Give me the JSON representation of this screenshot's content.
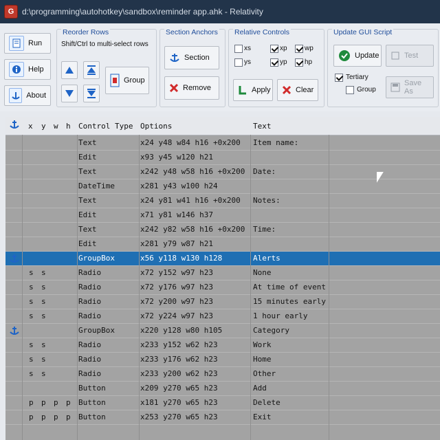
{
  "window": {
    "title": "d:\\programming\\autohotkey\\sandbox\\reminder app.ahk - Relativity"
  },
  "toolbar": {
    "left_buttons": [
      "Run",
      "Help",
      "About"
    ],
    "reorder_rows": {
      "title": "Reorder Rows",
      "hint": "Shift/Ctrl to multi-select rows",
      "group_label": "Group"
    },
    "section_anchors": {
      "title": "Section Anchors",
      "section_label": "Section",
      "remove_label": "Remove"
    },
    "relative_controls": {
      "title": "Relative Controls",
      "checkboxes": [
        {
          "label": "xs",
          "checked": false
        },
        {
          "label": "ys",
          "checked": false
        },
        {
          "label": "xp",
          "checked": true
        },
        {
          "label": "yp",
          "checked": true
        },
        {
          "label": "wp",
          "checked": true
        },
        {
          "label": "hp",
          "checked": true
        }
      ],
      "apply_label": "Apply",
      "clear_label": "Clear"
    },
    "update_gui": {
      "title": "Update GUI Script",
      "update_label": "Update",
      "test_label": "Test",
      "save_label": "Save As",
      "checkboxes": [
        {
          "label": "Tertiary",
          "checked": true
        },
        {
          "label": "Group",
          "checked": false
        }
      ]
    }
  },
  "grid": {
    "headers": [
      "x",
      "y",
      "w",
      "h",
      "Control Type",
      "Options",
      "Text"
    ],
    "rows": [
      {
        "anchor": "",
        "x": "",
        "y": "",
        "w": "",
        "h": "",
        "type": "Text",
        "options": "x24 y48 w84 h16 +0x200",
        "text": "Item name:"
      },
      {
        "anchor": "",
        "x": "",
        "y": "",
        "w": "",
        "h": "",
        "type": "Edit",
        "options": "x93 y45 w120 h21",
        "text": ""
      },
      {
        "anchor": "",
        "x": "",
        "y": "",
        "w": "",
        "h": "",
        "type": "Text",
        "options": "x242 y48 w58 h16 +0x200",
        "text": "Date:"
      },
      {
        "anchor": "",
        "x": "",
        "y": "",
        "w": "",
        "h": "",
        "type": "DateTime",
        "options": "x281 y43 w100 h24",
        "text": ""
      },
      {
        "anchor": "",
        "x": "",
        "y": "",
        "w": "",
        "h": "",
        "type": "Text",
        "options": "x24 y81 w41 h16 +0x200",
        "text": "Notes:"
      },
      {
        "anchor": "",
        "x": "",
        "y": "",
        "w": "",
        "h": "",
        "type": "Edit",
        "options": "x71 y81 w146 h37",
        "text": ""
      },
      {
        "anchor": "",
        "x": "",
        "y": "",
        "w": "",
        "h": "",
        "type": "Text",
        "options": "x242 y82 w58 h16 +0x200",
        "text": "Time:"
      },
      {
        "anchor": "",
        "x": "",
        "y": "",
        "w": "",
        "h": "",
        "type": "Edit",
        "options": "x281 y79 w87 h21",
        "text": ""
      },
      {
        "anchor": "anchor",
        "x": "",
        "y": "",
        "w": "",
        "h": "",
        "type": "GroupBox",
        "options": "x56 y118 w130 h128",
        "text": "Alerts",
        "selected": true
      },
      {
        "anchor": "",
        "x": "s",
        "y": "s",
        "w": "",
        "h": "",
        "type": "Radio",
        "options": "x72 y152 w97 h23",
        "text": "None"
      },
      {
        "anchor": "",
        "x": "s",
        "y": "s",
        "w": "",
        "h": "",
        "type": "Radio",
        "options": "x72 y176 w97 h23",
        "text": "At time of event"
      },
      {
        "anchor": "",
        "x": "s",
        "y": "s",
        "w": "",
        "h": "",
        "type": "Radio",
        "options": "x72 y200 w97 h23",
        "text": "15 minutes early"
      },
      {
        "anchor": "",
        "x": "s",
        "y": "s",
        "w": "",
        "h": "",
        "type": "Radio",
        "options": "x72 y224 w97 h23",
        "text": "1 hour early"
      },
      {
        "anchor": "anchor",
        "x": "",
        "y": "",
        "w": "",
        "h": "",
        "type": "GroupBox",
        "options": "x220 y128 w80 h105",
        "text": "Category"
      },
      {
        "anchor": "",
        "x": "s",
        "y": "s",
        "w": "",
        "h": "",
        "type": "Radio",
        "options": "x233 y152 w62 h23",
        "text": "Work"
      },
      {
        "anchor": "",
        "x": "s",
        "y": "s",
        "w": "",
        "h": "",
        "type": "Radio",
        "options": "x233 y176 w62 h23",
        "text": "Home"
      },
      {
        "anchor": "",
        "x": "s",
        "y": "s",
        "w": "",
        "h": "",
        "type": "Radio",
        "options": "x233 y200 w62 h23",
        "text": "Other"
      },
      {
        "anchor": "",
        "x": "",
        "y": "",
        "w": "",
        "h": "",
        "type": "Button",
        "options": "x209 y270 w65 h23",
        "text": "Add"
      },
      {
        "anchor": "",
        "x": "p",
        "y": "p",
        "w": "p",
        "h": "p",
        "type": "Button",
        "options": "x181 y270 w65 h23",
        "text": "Delete"
      },
      {
        "anchor": "",
        "x": "p",
        "y": "p",
        "w": "p",
        "h": "p",
        "type": "Button",
        "options": "x253 y270 w65 h23",
        "text": "Exit"
      }
    ]
  },
  "colors": {
    "selection": "#1f6fb3",
    "grid_bg": "#a3a3a3",
    "titlebar": "#22344a"
  },
  "icons": {
    "run": "document-icon",
    "help": "info-icon",
    "about": "anchor-icon",
    "up": "arrow-up-icon",
    "down": "arrow-down-icon",
    "top": "move-top-icon",
    "bottom": "move-bottom-icon",
    "group": "group-icon",
    "section": "anchor-icon",
    "remove": "x-icon",
    "apply": "L-icon",
    "clear": "x-icon",
    "update": "check-circle-icon",
    "test": "test-icon",
    "save": "save-icon",
    "anchor_row": "anchor-icon"
  }
}
